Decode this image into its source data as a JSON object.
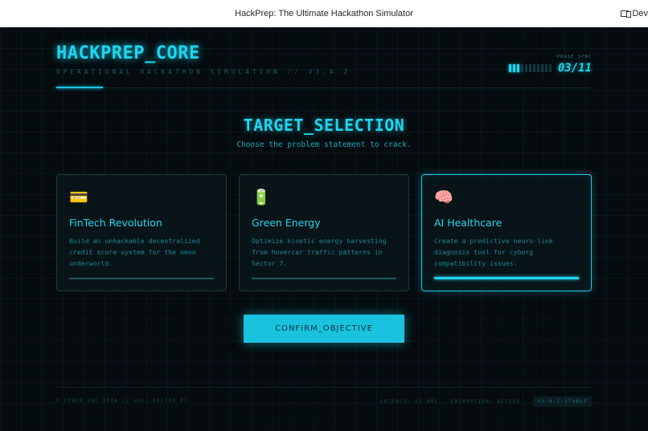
{
  "browser": {
    "title": "HackPrep: The Ultimate Hackathon Simulator",
    "right_label": "Dev"
  },
  "header": {
    "brand": "HACKPREP_CORE",
    "subtitle": "OPERATIONAL HACKATHON SIMULATION // V3.4.2",
    "phase_label": "PHASE_SYNC",
    "phase_counter": "03/11",
    "phase_progress": {
      "completed": 3,
      "total": 11
    }
  },
  "section": {
    "title": "TARGET_SELECTION",
    "subtitle": "Choose the problem statement to crack."
  },
  "cards": [
    {
      "icon": "credit-card-icon",
      "glyph": "💳",
      "title": "FinTech Revolution",
      "description": "Build an unhackable decentralized credit score system for the neon underworld.",
      "selected": false
    },
    {
      "icon": "battery-icon",
      "glyph": "🔋",
      "title": "Green Energy",
      "description": "Optimize kinetic energy harvesting from hovercar traffic patterns in Sector 7.",
      "selected": false
    },
    {
      "icon": "brain-icon",
      "glyph": "🧠",
      "title": "AI Healthcare",
      "description": "Create a predictive neuro-link diagnosis tool for cyborg compatibility issues.",
      "selected": true
    }
  ],
  "confirm_button": "CONFIRM_OBJECTIVE",
  "footer": {
    "left": "© CYBER_INC.2024 // LOC: SECTOR_07",
    "latency": "LATENCY: 12.4MS",
    "encryption": "ENCRYPTION: ACTIVE",
    "version": "V3.4.2-STABLE"
  },
  "colors": {
    "accent": "#1fd6f0",
    "background": "#050b0e",
    "button": "#19c3df"
  }
}
